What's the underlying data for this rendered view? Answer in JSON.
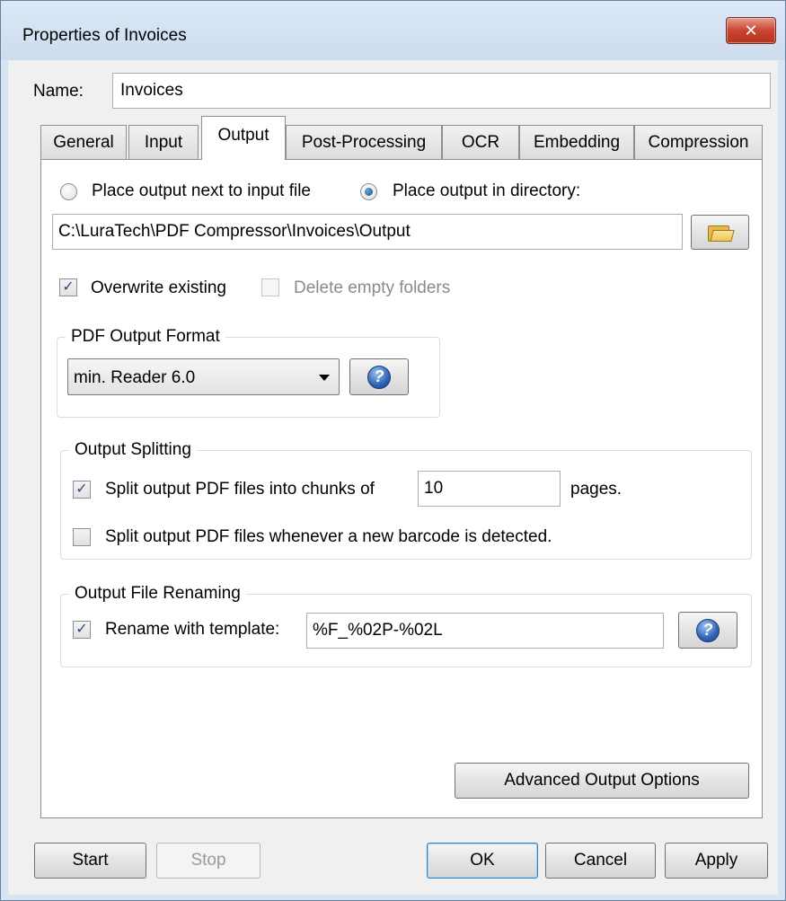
{
  "window": {
    "title": "Properties of Invoices",
    "close_label": "✕"
  },
  "name": {
    "label": "Name:",
    "value": "Invoices"
  },
  "tabs": [
    {
      "label": "General"
    },
    {
      "label": "Input"
    },
    {
      "label": "Output"
    },
    {
      "label": "Post-Processing"
    },
    {
      "label": "OCR"
    },
    {
      "label": "Embedding"
    },
    {
      "label": "Compression"
    }
  ],
  "output": {
    "radio_next_to_input": "Place output next to input file",
    "radio_in_directory": "Place output in directory:",
    "directory_path": "C:\\LuraTech\\PDF Compressor\\Invoices\\Output",
    "overwrite_existing": "Overwrite existing",
    "delete_empty_folders": "Delete empty folders",
    "pdf_format": {
      "group_title": "PDF Output Format",
      "selected": "min. Reader 6.0"
    },
    "splitting": {
      "group_title": "Output Splitting",
      "split_chunks_label": "Split output PDF files into chunks of",
      "chunk_size": "10",
      "pages_label": "pages.",
      "split_barcode_label": "Split output PDF files whenever a new barcode is detected."
    },
    "renaming": {
      "group_title": "Output File Renaming",
      "rename_label": "Rename with template:",
      "template": "%F_%02P-%02L"
    },
    "advanced_button": "Advanced Output Options"
  },
  "footer": {
    "start": "Start",
    "stop": "Stop",
    "ok": "OK",
    "cancel": "Cancel",
    "apply": "Apply"
  },
  "help_glyph": "?"
}
